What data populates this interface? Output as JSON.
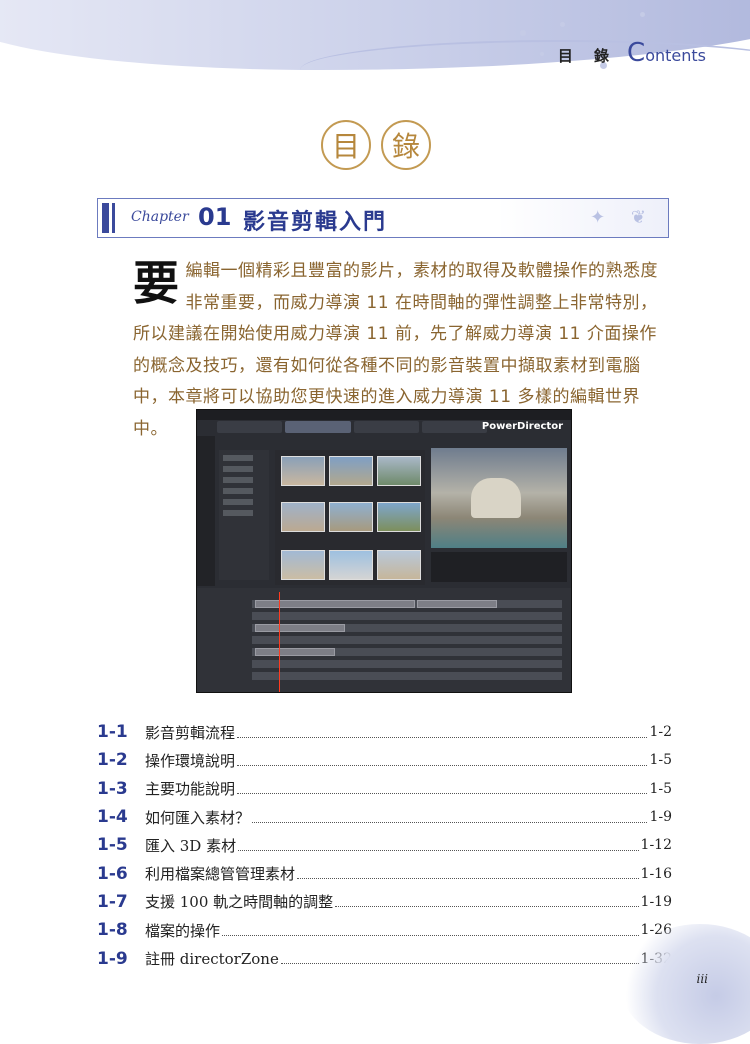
{
  "header": {
    "title_zh": "目 錄",
    "title_en_cap": "C",
    "title_en_rest": "ontents"
  },
  "big_title": {
    "char1": "目",
    "char2": "錄"
  },
  "chapter": {
    "label": "Chapter",
    "number": "01",
    "title": "影音剪輯入門"
  },
  "intro": {
    "dropcap": "要",
    "text": "編輯一個精彩且豐富的影片，素材的取得及軟體操作的熟悉度非常重要，而威力導演 11 在時間軸的彈性調整上非常特別，所以建議在開始使用威力導演 11 前，先了解威力導演 11 介面操作的概念及技巧，還有如何從各種不同的影音裝置中擷取素材到電腦中，本章將可以協助您更快速的進入威力導演 11 多樣的編輯世界中。"
  },
  "screenshot": {
    "brand": "PowerDirector"
  },
  "toc": [
    {
      "num": "1-1",
      "title": "影音剪輯流程",
      "page": "1-2"
    },
    {
      "num": "1-2",
      "title": "操作環境說明",
      "page": "1-5"
    },
    {
      "num": "1-3",
      "title": "主要功能說明",
      "page": "1-5"
    },
    {
      "num": "1-4",
      "title": "如何匯入素材？",
      "page": "1-9"
    },
    {
      "num": "1-5",
      "title": "匯入 3D 素材",
      "page": "1-12"
    },
    {
      "num": "1-6",
      "title": "利用檔案總管管理素材",
      "page": "1-16"
    },
    {
      "num": "1-7",
      "title": "支援 100 軌之時間軸的調整",
      "page": "1-19"
    },
    {
      "num": "1-8",
      "title": "檔案的操作",
      "page": "1-26"
    },
    {
      "num": "1-9",
      "title": "註冊 directorZone",
      "page": "1-32"
    }
  ],
  "footer": {
    "page_number": "iii"
  },
  "colors": {
    "accent_blue": "#2a3a8f",
    "intro_brown": "#8a6530",
    "gold": "#c39a52"
  }
}
